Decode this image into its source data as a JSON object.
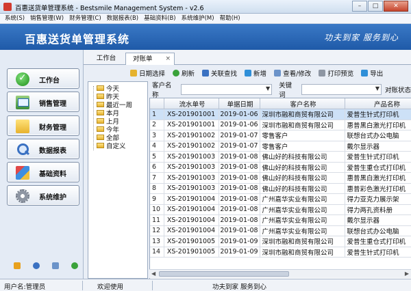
{
  "window": {
    "title": "百惠送货单管理系统 - Bestsmile Management System - v2.6",
    "minimize": "–",
    "maximize": "□",
    "close": "✕"
  },
  "menu": [
    "系统(S)",
    "销售管理(W)",
    "财务管理(C)",
    "数据报表(B)",
    "基础资料(B)",
    "系统维护(M)",
    "帮助(H)"
  ],
  "banner": {
    "brand": "百惠送货单管理系统",
    "slogan": "功夫到家 服务到心"
  },
  "sidebar": {
    "items": [
      {
        "label": "工作台",
        "icon": "check-icon"
      },
      {
        "label": "销售管理",
        "icon": "sales-icon"
      },
      {
        "label": "财务管理",
        "icon": "folder-icon"
      },
      {
        "label": "数据报表",
        "icon": "search-icon"
      },
      {
        "label": "基础资料",
        "icon": "database-icon"
      },
      {
        "label": "系统维护",
        "icon": "gear-icon"
      }
    ]
  },
  "tabs": [
    {
      "label": "工作台"
    },
    {
      "label": "对账单",
      "close": "×"
    }
  ],
  "toolbar": [
    "日期选择",
    "刷新",
    "关联查找",
    "新增",
    "查看/修改",
    "打印预览",
    "导出"
  ],
  "tree": [
    "今天",
    "昨天",
    "最近一周",
    "本月",
    "上月",
    "今年",
    "全部",
    "自定义"
  ],
  "filter": {
    "customer_label": "客户名称",
    "keyword_label": "关键词",
    "status_label": "对账状态"
  },
  "grid": {
    "columns": [
      "",
      "流水单号",
      "单据日期",
      "客户名称",
      "产品名称"
    ],
    "rows": [
      [
        "1",
        "XS-201901001",
        "2019-01-06",
        "深圳市融和商贸有限公司",
        "爱普生针式打印机"
      ],
      [
        "2",
        "XS-201901001",
        "2019-01-06",
        "深圳市融和商贸有限公司",
        "惠普黑白激光打印机"
      ],
      [
        "3",
        "XS-201901002",
        "2019-01-07",
        "零售客户",
        "联想台式办公电脑"
      ],
      [
        "4",
        "XS-201901002",
        "2019-01-07",
        "零售客户",
        "戴尔显示器"
      ],
      [
        "5",
        "XS-201901003",
        "2019-01-08",
        "佛山好的科技有限公司",
        "爱普生针式打印机"
      ],
      [
        "6",
        "XS-201901003",
        "2019-01-08",
        "佛山好的科技有限公司",
        "爱普生重仓式打印机"
      ],
      [
        "7",
        "XS-201901003",
        "2019-01-08",
        "佛山好的科技有限公司",
        "惠普黑白激光打印机"
      ],
      [
        "8",
        "XS-201901003",
        "2019-01-08",
        "佛山好的科技有限公司",
        "惠普彩色激光打印机"
      ],
      [
        "9",
        "XS-201901004",
        "2019-01-08",
        "广州嘉华实业有限公司",
        "得力亚克力展示架"
      ],
      [
        "10",
        "XS-201901004",
        "2019-01-08",
        "广州嘉华实业有限公司",
        "得力两孔资料册"
      ],
      [
        "11",
        "XS-201901004",
        "2019-01-08",
        "广州嘉华实业有限公司",
        "戴尔显示器"
      ],
      [
        "12",
        "XS-201901004",
        "2019-01-08",
        "广州嘉华实业有限公司",
        "联想台式办公电脑"
      ],
      [
        "13",
        "XS-201901005",
        "2019-01-09",
        "深圳市融和商贸有限公司",
        "爱普生重仓式打印机"
      ],
      [
        "14",
        "XS-201901005",
        "2019-01-09",
        "深圳市融和商贸有限公司",
        "爱普生针式打印机"
      ]
    ]
  },
  "status": {
    "user": "用户名:管理员",
    "welcome": "欢迎使用",
    "slogan": "功夫到家 服务到心"
  },
  "colors": {
    "banner": "#2a66b5",
    "selected_row": "#cde1f7"
  }
}
